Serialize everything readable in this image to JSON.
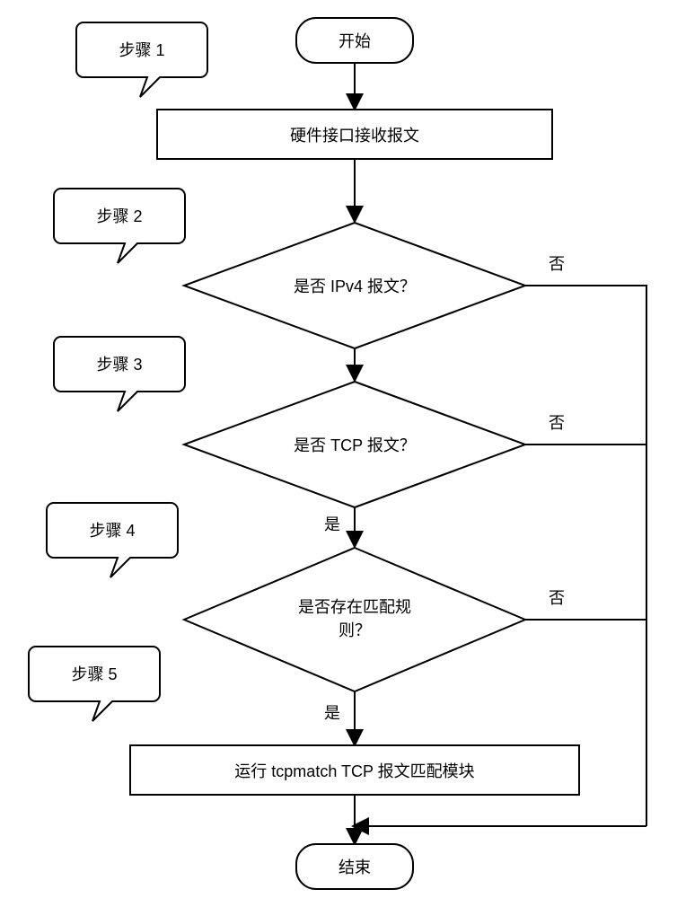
{
  "flow": {
    "start": "开始",
    "end": "结束",
    "process1": "硬件接口接收报文",
    "decision2": "是否 IPv4 报文？",
    "decision3": "是否 TCP 报文？",
    "decision4_l1": "是否存在匹配规",
    "decision4_l2": "则？",
    "process5": "运行 tcpmatch TCP 报文匹配模块",
    "yes": "是",
    "no": "否"
  },
  "callouts": {
    "c1": "步骤 1",
    "c2": "步骤 2",
    "c3": "步骤 3",
    "c4": "步骤 4",
    "c5": "步骤 5"
  }
}
